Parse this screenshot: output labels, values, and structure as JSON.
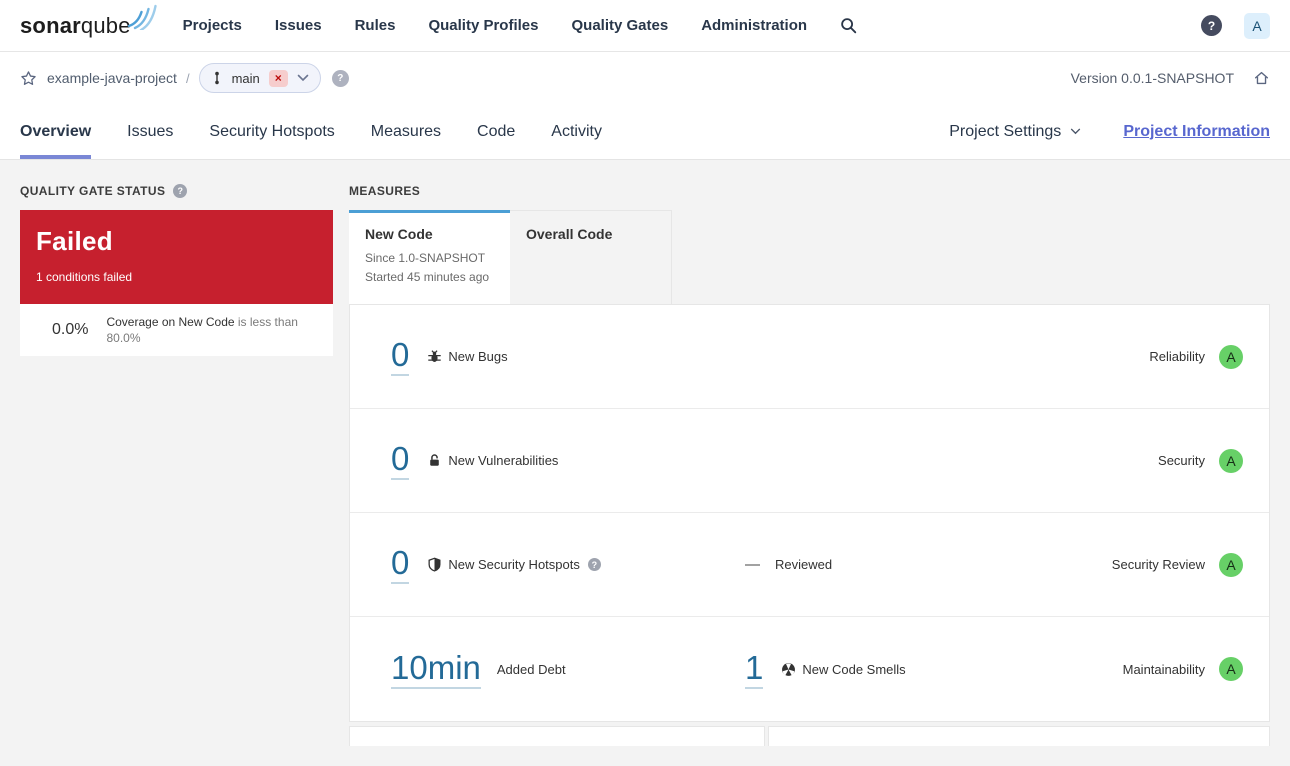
{
  "nav": {
    "logo": {
      "bold": "sonar",
      "regular": "qube"
    },
    "items": [
      "Projects",
      "Issues",
      "Rules",
      "Quality Profiles",
      "Quality Gates",
      "Administration"
    ],
    "help": "?",
    "avatar": "A"
  },
  "breadcrumb": {
    "project": "example-java-project",
    "separator": "/",
    "branch": "main",
    "close": "×",
    "help": "?",
    "version_label": "Version 0.0.1-SNAPSHOT"
  },
  "tabs": {
    "items": [
      "Overview",
      "Issues",
      "Security Hotspots",
      "Measures",
      "Code",
      "Activity"
    ],
    "active": "Overview",
    "settings_label": "Project Settings",
    "info_label": "Project Information"
  },
  "quality_gate": {
    "heading": "QUALITY GATE STATUS",
    "help": "?",
    "status": "Failed",
    "conditions_summary": "1 conditions failed",
    "condition": {
      "value": "0.0%",
      "metric": "Coverage on New Code",
      "rest": " is less than 80.0%"
    }
  },
  "measures": {
    "heading": "MEASURES",
    "tabs": [
      {
        "label": "New Code",
        "line1": "Since 1.0-SNAPSHOT",
        "line2": "Started 45 minutes ago"
      },
      {
        "label": "Overall Code"
      }
    ],
    "rows": [
      {
        "value": "0",
        "label": "New Bugs",
        "rating_label": "Reliability",
        "rating": "A"
      },
      {
        "value": "0",
        "label": "New Vulnerabilities",
        "rating_label": "Security",
        "rating": "A"
      },
      {
        "value": "0",
        "label": "New Security Hotspots",
        "help": "?",
        "mid_dash": "—",
        "mid_label": "Reviewed",
        "rating_label": "Security Review",
        "rating": "A"
      },
      {
        "value": "10min",
        "label": "Added Debt",
        "value2": "1",
        "label2": "New Code Smells",
        "rating_label": "Maintainability",
        "rating": "A"
      }
    ]
  },
  "colors": {
    "failed_red": "#c6202e",
    "rating_green": "#67d067",
    "link_blue": "#236a97",
    "new_code_tab_blue": "#4b9fd5",
    "active_tab_underline": "#7a87d5",
    "project_info_link": "#5867cf",
    "page_background": "#f3f3f3"
  }
}
